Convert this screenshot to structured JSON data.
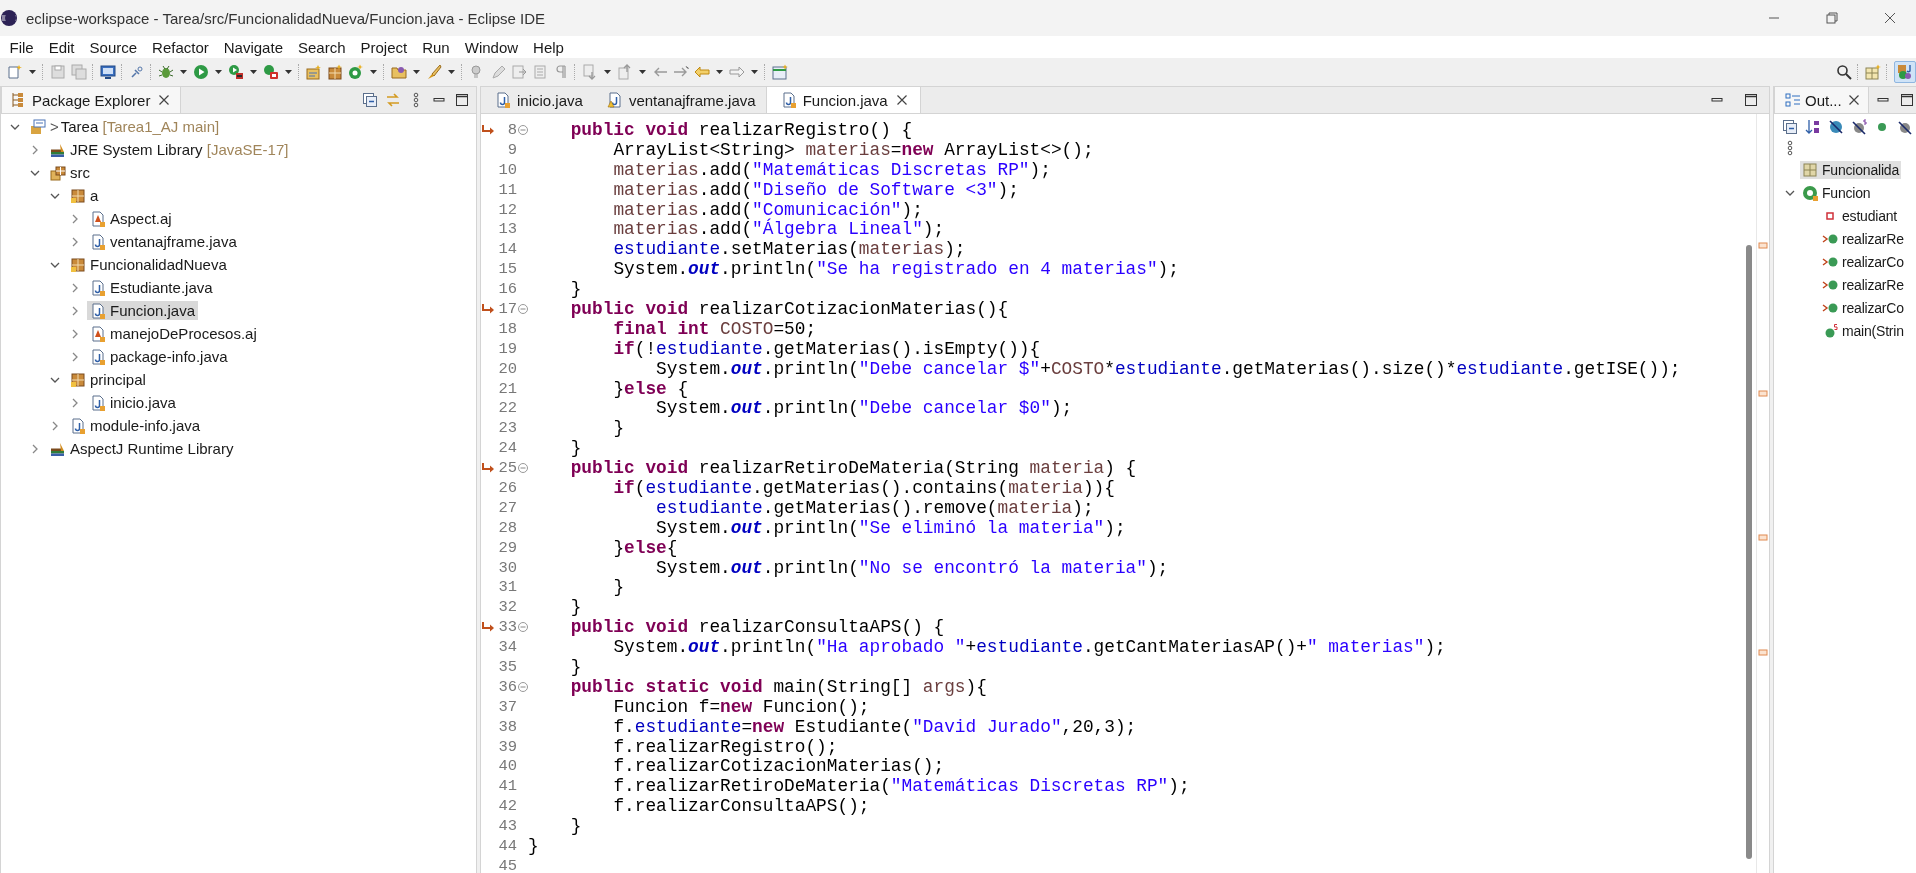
{
  "window": {
    "title": "eclipse-workspace - Tarea/src/FuncionalidadNueva/Funcion.java - Eclipse IDE"
  },
  "menu": [
    "File",
    "Edit",
    "Source",
    "Refactor",
    "Navigate",
    "Search",
    "Project",
    "Run",
    "Window",
    "Help"
  ],
  "package_explorer": {
    "title": "Package Explorer",
    "tree": [
      {
        "label": "Tarea",
        "prefix": ">",
        "decoration": "[Tarea1_AJ main]",
        "kind": "project",
        "expanded": true,
        "selected": false,
        "children": [
          {
            "label": "JRE System Library",
            "decoration": "[JavaSE-17]",
            "kind": "library",
            "expanded": false,
            "selected": false
          },
          {
            "label": "src",
            "kind": "source-folder",
            "expanded": true,
            "selected": false,
            "children": [
              {
                "label": "a",
                "kind": "package",
                "expanded": true,
                "selected": false,
                "children": [
                  {
                    "label": "Aspect.aj",
                    "kind": "aspect",
                    "expanded": false,
                    "selected": false
                  },
                  {
                    "label": "ventanajframe.java",
                    "kind": "java",
                    "expanded": false,
                    "selected": false
                  }
                ]
              },
              {
                "label": "FuncionalidadNueva",
                "kind": "package",
                "expanded": true,
                "selected": false,
                "children": [
                  {
                    "label": "Estudiante.java",
                    "kind": "java",
                    "expanded": false,
                    "selected": false
                  },
                  {
                    "label": "Funcion.java",
                    "kind": "java",
                    "expanded": false,
                    "selected": true
                  },
                  {
                    "label": "manejoDeProcesos.aj",
                    "kind": "aspect",
                    "expanded": false,
                    "selected": false
                  },
                  {
                    "label": "package-info.java",
                    "kind": "java",
                    "expanded": false,
                    "selected": false
                  }
                ]
              },
              {
                "label": "principal",
                "kind": "package",
                "expanded": true,
                "selected": false,
                "children": [
                  {
                    "label": "inicio.java",
                    "kind": "java",
                    "expanded": false,
                    "selected": false
                  }
                ]
              },
              {
                "label": "module-info.java",
                "kind": "java",
                "expanded": false,
                "selected": false
              }
            ]
          },
          {
            "label": "AspectJ Runtime Library",
            "kind": "library",
            "expanded": false,
            "selected": false
          }
        ]
      }
    ]
  },
  "editor": {
    "tabs": [
      {
        "label": "inicio.java",
        "kind": "java",
        "selected": false
      },
      {
        "label": "ventanajframe.java",
        "kind": "java-warning",
        "selected": false
      },
      {
        "label": "Funcion.java",
        "kind": "java",
        "selected": true
      }
    ],
    "lines": [
      {
        "number": "8",
        "override": true,
        "fold": true,
        "code": [
          {
            "kind": "k",
            "text": "    public void"
          },
          {
            "kind": "t",
            "text": " realizarRegistro() {"
          }
        ]
      },
      {
        "number": "9",
        "override": false,
        "fold": false,
        "code": [
          {
            "kind": "t",
            "text": "        ArrayList<String> "
          },
          {
            "kind": "v",
            "text": "materias"
          },
          {
            "kind": "t",
            "text": "="
          },
          {
            "kind": "k",
            "text": "new"
          },
          {
            "kind": "t",
            "text": " ArrayList<>();"
          }
        ]
      },
      {
        "number": "10",
        "override": false,
        "fold": false,
        "code": [
          {
            "kind": "v",
            "text": "        materias"
          },
          {
            "kind": "t",
            "text": ".add("
          },
          {
            "kind": "s",
            "text": "\"Matemáticas Discretas RP\""
          },
          {
            "kind": "t",
            "text": ");"
          }
        ]
      },
      {
        "number": "11",
        "override": false,
        "fold": false,
        "code": [
          {
            "kind": "v",
            "text": "        materias"
          },
          {
            "kind": "t",
            "text": ".add("
          },
          {
            "kind": "s",
            "text": "\"Diseño de Software <3\""
          },
          {
            "kind": "t",
            "text": ");"
          }
        ]
      },
      {
        "number": "12",
        "override": false,
        "fold": false,
        "code": [
          {
            "kind": "v",
            "text": "        materias"
          },
          {
            "kind": "t",
            "text": ".add("
          },
          {
            "kind": "s",
            "text": "\"Comunicación\""
          },
          {
            "kind": "t",
            "text": ");"
          }
        ]
      },
      {
        "number": "13",
        "override": false,
        "fold": false,
        "code": [
          {
            "kind": "v",
            "text": "        materias"
          },
          {
            "kind": "t",
            "text": ".add("
          },
          {
            "kind": "s",
            "text": "\"Álgebra Lineal\""
          },
          {
            "kind": "t",
            "text": ");"
          }
        ]
      },
      {
        "number": "14",
        "override": false,
        "fold": false,
        "code": [
          {
            "kind": "f",
            "text": "        estudiante"
          },
          {
            "kind": "t",
            "text": ".setMaterias("
          },
          {
            "kind": "v",
            "text": "materias"
          },
          {
            "kind": "t",
            "text": ");"
          }
        ]
      },
      {
        "number": "15",
        "override": false,
        "fold": false,
        "code": [
          {
            "kind": "t",
            "text": "        System."
          },
          {
            "kind": "o",
            "text": "out"
          },
          {
            "kind": "t",
            "text": ".println("
          },
          {
            "kind": "s",
            "text": "\"Se ha registrado en 4 materias\""
          },
          {
            "kind": "t",
            "text": ");"
          }
        ]
      },
      {
        "number": "16",
        "override": false,
        "fold": false,
        "code": [
          {
            "kind": "t",
            "text": "    }"
          }
        ]
      },
      {
        "number": "17",
        "override": true,
        "fold": true,
        "code": [
          {
            "kind": "k",
            "text": "    public void"
          },
          {
            "kind": "t",
            "text": " realizarCotizacionMaterias(){"
          }
        ]
      },
      {
        "number": "18",
        "override": false,
        "fold": false,
        "code": [
          {
            "kind": "k",
            "text": "        final int"
          },
          {
            "kind": "v",
            "text": " COSTO"
          },
          {
            "kind": "t",
            "text": "=50;"
          }
        ]
      },
      {
        "number": "19",
        "override": false,
        "fold": false,
        "code": [
          {
            "kind": "k",
            "text": "        if"
          },
          {
            "kind": "t",
            "text": "(!"
          },
          {
            "kind": "f",
            "text": "estudiante"
          },
          {
            "kind": "t",
            "text": ".getMaterias().isEmpty()){"
          }
        ]
      },
      {
        "number": "20",
        "override": false,
        "fold": false,
        "code": [
          {
            "kind": "t",
            "text": "            System."
          },
          {
            "kind": "o",
            "text": "out"
          },
          {
            "kind": "t",
            "text": ".println("
          },
          {
            "kind": "s",
            "text": "\"Debe cancelar $\""
          },
          {
            "kind": "t",
            "text": "+"
          },
          {
            "kind": "v",
            "text": "COSTO"
          },
          {
            "kind": "t",
            "text": "*"
          },
          {
            "kind": "f",
            "text": "estudiante"
          },
          {
            "kind": "t",
            "text": ".getMaterias().size()*"
          },
          {
            "kind": "f",
            "text": "estudiante"
          },
          {
            "kind": "t",
            "text": ".getISE());"
          }
        ]
      },
      {
        "number": "21",
        "override": false,
        "fold": false,
        "code": [
          {
            "kind": "t",
            "text": "        }"
          },
          {
            "kind": "k",
            "text": "else"
          },
          {
            "kind": "t",
            "text": " {"
          }
        ]
      },
      {
        "number": "22",
        "override": false,
        "fold": false,
        "code": [
          {
            "kind": "t",
            "text": "            System."
          },
          {
            "kind": "o",
            "text": "out"
          },
          {
            "kind": "t",
            "text": ".println("
          },
          {
            "kind": "s",
            "text": "\"Debe cancelar $0\""
          },
          {
            "kind": "t",
            "text": ");"
          }
        ]
      },
      {
        "number": "23",
        "override": false,
        "fold": false,
        "code": [
          {
            "kind": "t",
            "text": "        }"
          }
        ]
      },
      {
        "number": "24",
        "override": false,
        "fold": false,
        "code": [
          {
            "kind": "t",
            "text": "    }"
          }
        ]
      },
      {
        "number": "25",
        "override": true,
        "fold": true,
        "code": [
          {
            "kind": "k",
            "text": "    public void"
          },
          {
            "kind": "t",
            "text": " realizarRetiroDeMateria(String "
          },
          {
            "kind": "v",
            "text": "materia"
          },
          {
            "kind": "t",
            "text": ") {"
          }
        ]
      },
      {
        "number": "26",
        "override": false,
        "fold": false,
        "code": [
          {
            "kind": "k",
            "text": "        if"
          },
          {
            "kind": "t",
            "text": "("
          },
          {
            "kind": "f",
            "text": "estudiante"
          },
          {
            "kind": "t",
            "text": ".getMaterias().contains("
          },
          {
            "kind": "v",
            "text": "materia"
          },
          {
            "kind": "t",
            "text": ")){"
          }
        ]
      },
      {
        "number": "27",
        "override": false,
        "fold": false,
        "code": [
          {
            "kind": "f",
            "text": "            estudiante"
          },
          {
            "kind": "t",
            "text": ".getMaterias().remove("
          },
          {
            "kind": "v",
            "text": "materia"
          },
          {
            "kind": "t",
            "text": ");"
          }
        ]
      },
      {
        "number": "28",
        "override": false,
        "fold": false,
        "code": [
          {
            "kind": "t",
            "text": "            System."
          },
          {
            "kind": "o",
            "text": "out"
          },
          {
            "kind": "t",
            "text": ".println("
          },
          {
            "kind": "s",
            "text": "\"Se eliminó la materia\""
          },
          {
            "kind": "t",
            "text": ");"
          }
        ]
      },
      {
        "number": "29",
        "override": false,
        "fold": false,
        "code": [
          {
            "kind": "t",
            "text": "        }"
          },
          {
            "kind": "k",
            "text": "else"
          },
          {
            "kind": "t",
            "text": "{"
          }
        ]
      },
      {
        "number": "30",
        "override": false,
        "fold": false,
        "code": [
          {
            "kind": "t",
            "text": "            System."
          },
          {
            "kind": "o",
            "text": "out"
          },
          {
            "kind": "t",
            "text": ".println("
          },
          {
            "kind": "s",
            "text": "\"No se encontró la materia\""
          },
          {
            "kind": "t",
            "text": ");"
          }
        ]
      },
      {
        "number": "31",
        "override": false,
        "fold": false,
        "code": [
          {
            "kind": "t",
            "text": "        }"
          }
        ]
      },
      {
        "number": "32",
        "override": false,
        "fold": false,
        "code": [
          {
            "kind": "t",
            "text": "    }"
          }
        ]
      },
      {
        "number": "33",
        "override": true,
        "fold": true,
        "code": [
          {
            "kind": "k",
            "text": "    public void"
          },
          {
            "kind": "t",
            "text": " realizarConsultaAPS() {"
          }
        ]
      },
      {
        "number": "34",
        "override": false,
        "fold": false,
        "code": [
          {
            "kind": "t",
            "text": "        System."
          },
          {
            "kind": "o",
            "text": "out"
          },
          {
            "kind": "t",
            "text": ".println("
          },
          {
            "kind": "s",
            "text": "\"Ha aprobado \""
          },
          {
            "kind": "t",
            "text": "+"
          },
          {
            "kind": "f",
            "text": "estudiante"
          },
          {
            "kind": "t",
            "text": ".getCantMateriasAP()+"
          },
          {
            "kind": "s",
            "text": "\" materias\""
          },
          {
            "kind": "t",
            "text": ");"
          }
        ]
      },
      {
        "number": "35",
        "override": false,
        "fold": false,
        "code": [
          {
            "kind": "t",
            "text": "    }"
          }
        ]
      },
      {
        "number": "36",
        "override": false,
        "fold": true,
        "code": [
          {
            "kind": "k",
            "text": "    public static void"
          },
          {
            "kind": "t",
            "text": " main(String[] "
          },
          {
            "kind": "v",
            "text": "args"
          },
          {
            "kind": "t",
            "text": "){"
          }
        ]
      },
      {
        "number": "37",
        "override": false,
        "fold": false,
        "code": [
          {
            "kind": "t",
            "text": "        Funcion f="
          },
          {
            "kind": "k",
            "text": "new"
          },
          {
            "kind": "t",
            "text": " Funcion();"
          }
        ]
      },
      {
        "number": "38",
        "override": false,
        "fold": false,
        "code": [
          {
            "kind": "t",
            "text": "        f."
          },
          {
            "kind": "f",
            "text": "estudiante"
          },
          {
            "kind": "t",
            "text": "="
          },
          {
            "kind": "k",
            "text": "new"
          },
          {
            "kind": "t",
            "text": " Estudiante("
          },
          {
            "kind": "s",
            "text": "\"David Jurado\""
          },
          {
            "kind": "t",
            "text": ",20,3);"
          }
        ]
      },
      {
        "number": "39",
        "override": false,
        "fold": false,
        "code": [
          {
            "kind": "t",
            "text": "        f.realizarRegistro();"
          }
        ]
      },
      {
        "number": "40",
        "override": false,
        "fold": false,
        "code": [
          {
            "kind": "t",
            "text": "        f.realizarCotizacionMaterias();"
          }
        ]
      },
      {
        "number": "41",
        "override": false,
        "fold": false,
        "code": [
          {
            "kind": "t",
            "text": "        f.realizarRetiroDeMateria("
          },
          {
            "kind": "s",
            "text": "\"Matemáticas Discretas RP\""
          },
          {
            "kind": "t",
            "text": ");"
          }
        ]
      },
      {
        "number": "42",
        "override": false,
        "fold": false,
        "code": [
          {
            "kind": "t",
            "text": "        f.realizarConsultaAPS();"
          }
        ]
      },
      {
        "number": "43",
        "override": false,
        "fold": false,
        "code": [
          {
            "kind": "t",
            "text": "    }"
          }
        ]
      },
      {
        "number": "44",
        "override": false,
        "fold": false,
        "code": [
          {
            "kind": "t",
            "text": "}"
          }
        ]
      },
      {
        "number": "45",
        "override": false,
        "fold": false
      }
    ]
  },
  "outline": {
    "title": "Out...",
    "tree": [
      {
        "label": "Funcionalida",
        "kind": "package",
        "selected": true
      },
      {
        "label": "Funcion",
        "kind": "class",
        "selected": false,
        "expanded": true,
        "children": [
          {
            "label": "estudiant",
            "kind": "private-field",
            "selected": false
          },
          {
            "label": "realizarRe",
            "kind": "override-method",
            "selected": false
          },
          {
            "label": "realizarCo",
            "kind": "override-method",
            "selected": false
          },
          {
            "label": "realizarRe",
            "kind": "override-method",
            "selected": false
          },
          {
            "label": "realizarCo",
            "kind": "override-method",
            "selected": false
          },
          {
            "label": "main(Strin",
            "kind": "static-method",
            "selected": false
          }
        ]
      }
    ]
  }
}
